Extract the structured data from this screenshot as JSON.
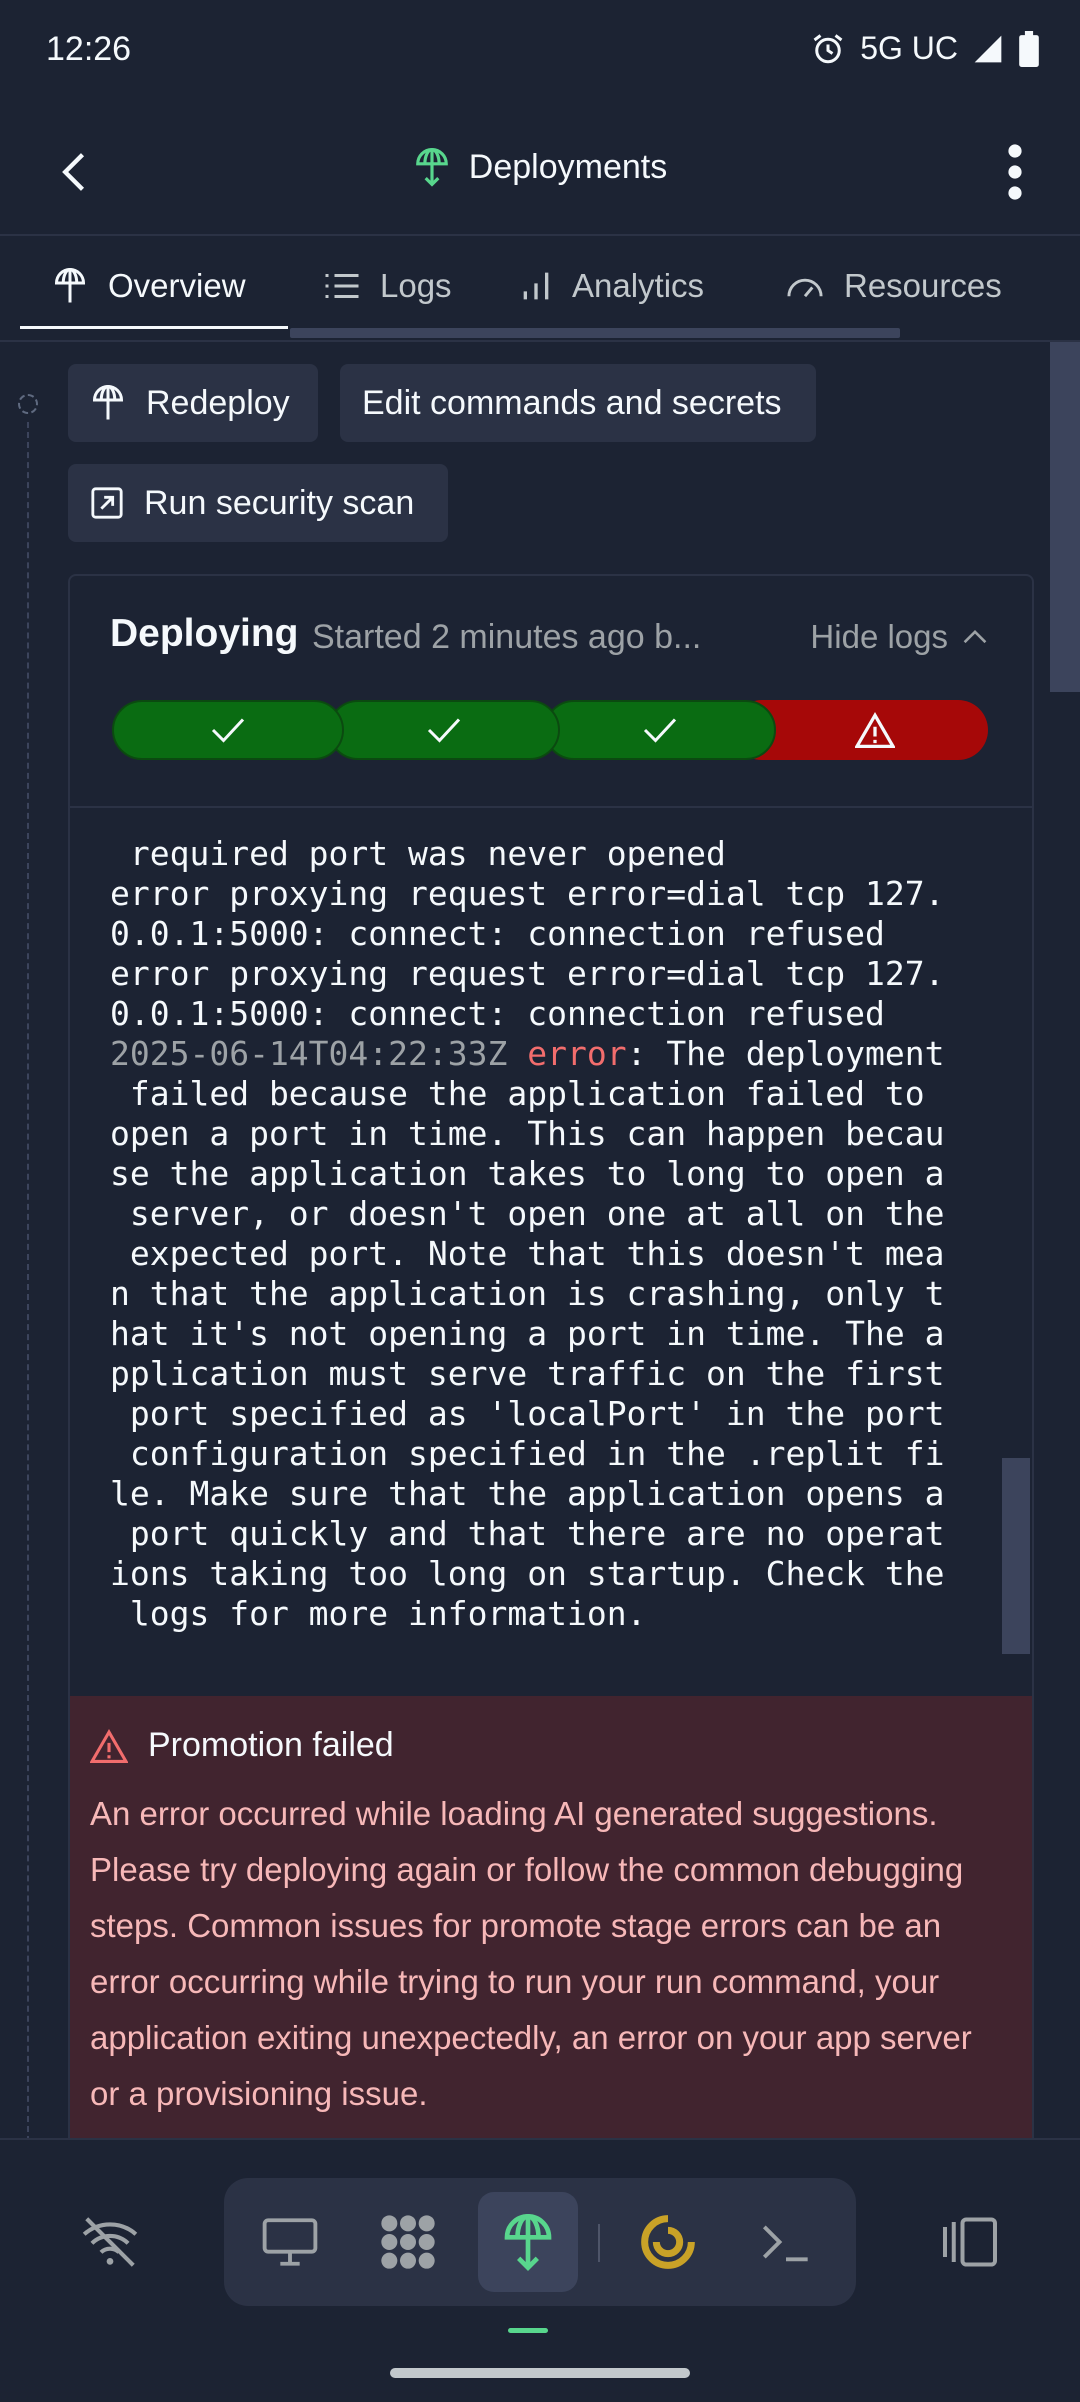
{
  "status_bar": {
    "time": "12:26",
    "network": "5G UC"
  },
  "header": {
    "title": "Deployments"
  },
  "tabs": [
    {
      "label": "Overview",
      "icon": "deploy-icon"
    },
    {
      "label": "Logs",
      "icon": "list-icon"
    },
    {
      "label": "Analytics",
      "icon": "bar-chart-icon"
    },
    {
      "label": "Resources",
      "icon": "gauge-icon"
    }
  ],
  "actions": {
    "redeploy": "Redeploy",
    "edit": "Edit commands and secrets",
    "security_scan": "Run security scan"
  },
  "deployment": {
    "status": "Deploying",
    "started": "Started 2 minutes ago b...",
    "hide_logs": "Hide logs",
    "steps": [
      "success",
      "success",
      "success",
      "failed"
    ]
  },
  "log": {
    "line1": " required port was never opened",
    "line2": "error proxying request error=dial tcp 127.",
    "line3": "0.0.1:5000: connect: connection refused",
    "line4": "error proxying request error=dial tcp 127.",
    "line5": "0.0.1:5000: connect: connection refused",
    "timestamp": "2025-06-14T04:22:33Z",
    "error_word": "error",
    "error_rest": ": The deployment",
    "line7": " failed because the application failed to",
    "line8": "open a port in time. This can happen becau",
    "line9": "se the application takes to long to open a",
    "line10": " server, or doesn't open one at all on the",
    "line11": " expected port. Note that this doesn't mea",
    "line12": "n that the application is crashing, only t",
    "line13": "hat it's not opening a port in time. The a",
    "line14": "pplication must serve traffic on the first",
    "line15": " port specified as 'localPort' in the port",
    "line16": " configuration specified in the .replit fi",
    "line17": "le. Make sure that the application opens a",
    "line18": " port quickly and that there are no operat",
    "line19": "ions taking too long on startup. Check the",
    "line20": " logs for more information."
  },
  "promotion": {
    "title": "Promotion failed",
    "body": "An error occurred while loading AI generated suggestions. Please try deploying again or follow the common debugging steps. Common issues for promote stage errors can be an error occurring while trying to run your run command, your application exiting unexpectedly, an error on your app server or a provisioning issue."
  },
  "bottom_nav": [
    "wifi-off-icon",
    "desktop-icon",
    "apps-icon",
    "deploy-icon",
    "spinner-icon",
    "terminal-icon",
    "split-view-icon"
  ],
  "colors": {
    "accent_green": "#58d68d",
    "success": "#0a6c12",
    "failure": "#a60808",
    "error_text": "#f26d6d"
  }
}
